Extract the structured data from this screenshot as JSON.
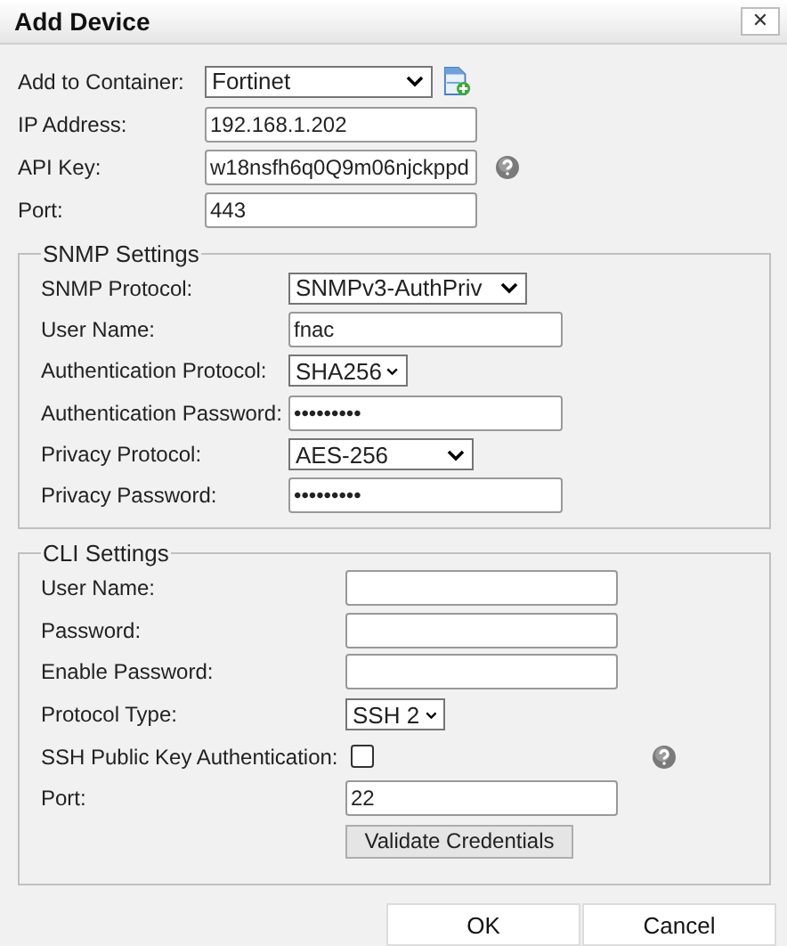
{
  "window": {
    "title": "Add Device",
    "close": "✕"
  },
  "fields": [
    {
      "kind": "select",
      "label": "Add to Container:",
      "value": "Fortinet",
      "add_button": true
    },
    {
      "kind": "text",
      "label": "IP Address:",
      "value": "192.168.1.202"
    },
    {
      "kind": "text",
      "label": "API Key:",
      "value": "w18nsfh6q0Q9m06njckppd",
      "help": true
    },
    {
      "kind": "text",
      "label": "Port:",
      "value": "443"
    }
  ],
  "sections": [
    {
      "title": "SNMP Settings",
      "fields": [
        {
          "kind": "select",
          "label": "SNMP Protocol:",
          "value": "SNMPv3-AuthPriv"
        },
        {
          "kind": "text",
          "label": "User Name:",
          "value": "fnac"
        },
        {
          "kind": "select",
          "label": "Authentication Protocol:",
          "value": "SHA256"
        },
        {
          "kind": "text",
          "label": "Authentication Password:",
          "value": "•••••••••"
        },
        {
          "kind": "select",
          "label": "Privacy Protocol:",
          "value": "AES-256"
        },
        {
          "kind": "text",
          "label": "Privacy Password:",
          "value": "•••••••••"
        }
      ]
    },
    {
      "title": "CLI Settings",
      "fields": [
        {
          "kind": "text",
          "label": "User Name:"
        },
        {
          "kind": "text",
          "label": "Password:"
        },
        {
          "kind": "text",
          "label": "Enable Password:"
        },
        {
          "kind": "select",
          "label": "Protocol Type:",
          "value": "SSH 2"
        },
        {
          "kind": "checkbox",
          "label": "SSH Public Key Authentication:",
          "checked": false,
          "help": true
        },
        {
          "kind": "text",
          "label": "Port:",
          "value": "22"
        },
        {
          "kind": "button",
          "value": "Validate Credentials"
        }
      ]
    }
  ],
  "buttons": [
    "OK",
    "Cancel"
  ]
}
